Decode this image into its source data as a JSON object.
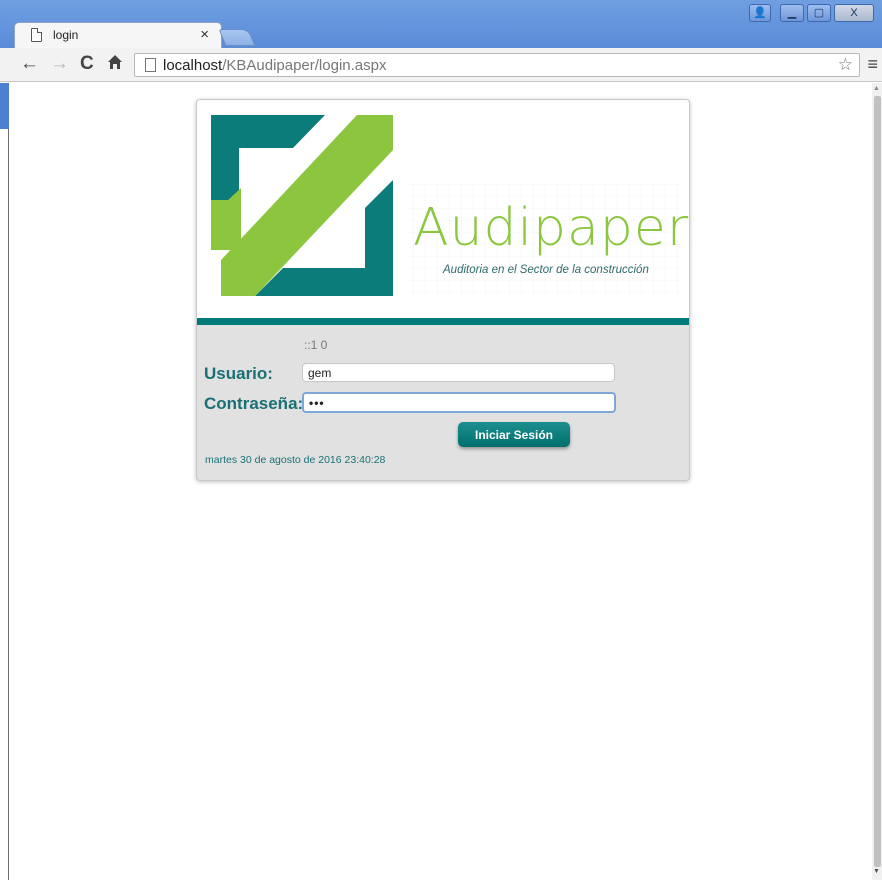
{
  "browser": {
    "tab_title": "login",
    "tab_close": "×",
    "url_host": "localhost",
    "url_path": "/KBAudipaper/login.aspx",
    "window_buttons": {
      "user": "👤",
      "minimize": "▁",
      "maximize": "▢",
      "close": "X"
    },
    "nav": {
      "back": "←",
      "forward": "→",
      "reload": "C",
      "home": "🏠",
      "star": "☆",
      "menu": "≡"
    }
  },
  "login": {
    "brand_name": "Audipaper",
    "tagline": "Auditoria en el Sector de la construcción",
    "ip_info": "::1 0",
    "username_label": "Usuario:",
    "username_value": "gem",
    "password_label": "Contraseña:",
    "password_value": "•••",
    "submit_label": "Iniciar Sesión",
    "datetime": "martes 30 de agosto de 2016 23:40:28"
  },
  "colors": {
    "brand_teal": "#007b7a",
    "brand_green": "#8cc63f",
    "label_teal": "#1a7074"
  }
}
